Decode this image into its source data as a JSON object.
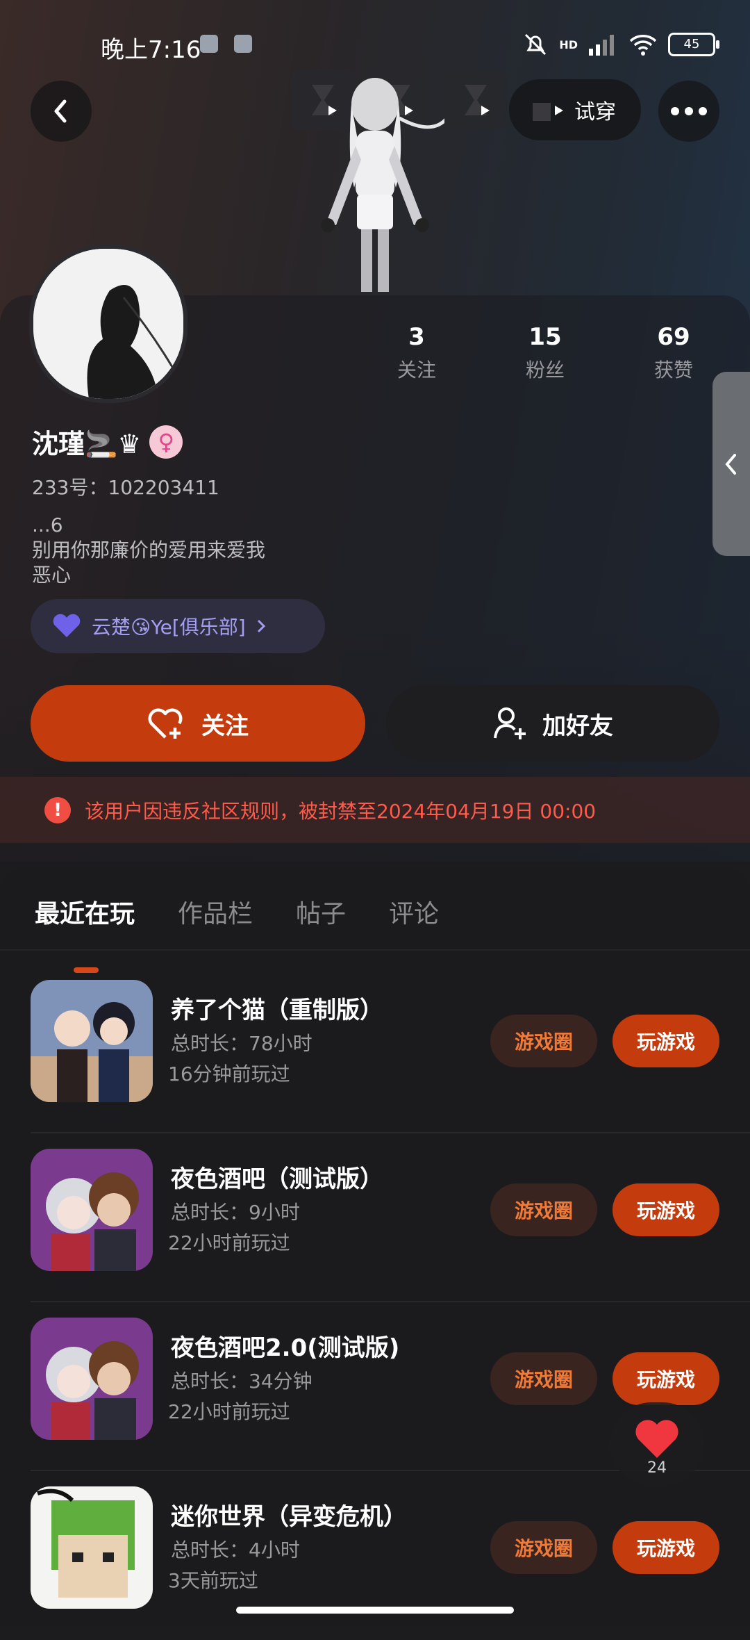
{
  "status_bar": {
    "time": "晚上7:16",
    "battery": "45",
    "network": "HD"
  },
  "header": {
    "try_on_label": "试穿",
    "back_icon": "back-icon",
    "more_icon": "more-icon"
  },
  "profile": {
    "name": "沈瑾🚬♛",
    "gender_symbol": "♀",
    "uid": "233号：102203411",
    "bio": "...6\n别用你那廉价的爱用来爱我\n恶心",
    "stats": [
      {
        "value": "3",
        "label": "关注"
      },
      {
        "value": "15",
        "label": "粉丝"
      },
      {
        "value": "69",
        "label": "获赞"
      }
    ],
    "club": "云楚😘Ye[俱乐部]"
  },
  "actions": {
    "follow": "关注",
    "add_friend": "加好友"
  },
  "ban_notice": "该用户因违反社区规则，被封禁至2024年04月19日 00:00",
  "tabs": [
    {
      "label": "最近在玩",
      "active": true
    },
    {
      "label": "作品栏",
      "active": false
    },
    {
      "label": "帖子",
      "active": false
    },
    {
      "label": "评论",
      "active": false
    }
  ],
  "games": [
    {
      "title": "养了个猫（重制版）",
      "duration": "总时长：78小时",
      "last_played": "16分钟前玩过",
      "circle_label": "游戏圈",
      "play_label": "玩游戏",
      "thumb_bg": "#7f93b8"
    },
    {
      "title": "夜色酒吧（测试版）",
      "duration": "总时长：9小时",
      "last_played": "22小时前玩过",
      "circle_label": "游戏圈",
      "play_label": "玩游戏",
      "thumb_bg": "#7a3a8e"
    },
    {
      "title": "夜色酒吧2.0(测试版)",
      "duration": "总时长：34分钟",
      "last_played": "22小时前玩过",
      "circle_label": "游戏圈",
      "play_label": "玩游戏",
      "thumb_bg": "#7a3a8e"
    },
    {
      "title": "迷你世界（异变危机）",
      "duration": "总时长：4小时",
      "last_played": "3天前玩过",
      "circle_label": "游戏圈",
      "play_label": "玩游戏",
      "thumb_bg": "#5fae3e"
    }
  ],
  "like_fab": {
    "count": "24"
  },
  "colors": {
    "accent": "#c43c0e",
    "ban_text": "#ff5a4a",
    "club_text": "#a39ef0"
  }
}
